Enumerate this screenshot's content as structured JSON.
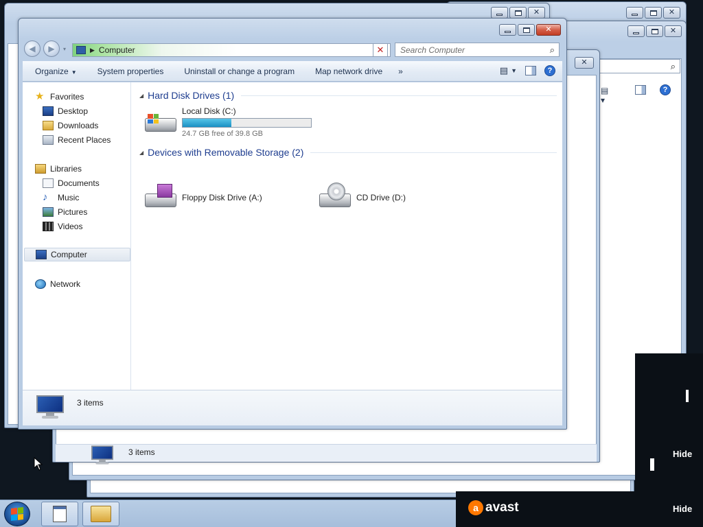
{
  "main_window": {
    "address_path": "Computer",
    "search_placeholder": "Search Computer",
    "toolbar": {
      "organize": "Organize",
      "system_properties": "System properties",
      "uninstall": "Uninstall or change a program",
      "map_network_drive": "Map network drive",
      "more": "»"
    },
    "nav": {
      "favorites": "Favorites",
      "desktop": "Desktop",
      "downloads": "Downloads",
      "recent_places": "Recent Places",
      "libraries": "Libraries",
      "documents": "Documents",
      "music": "Music",
      "pictures": "Pictures",
      "videos": "Videos",
      "computer": "Computer",
      "network": "Network"
    },
    "groups": {
      "hard_disk": "Hard Disk Drives (1)",
      "removable": "Devices with Removable Storage (2)"
    },
    "drives": {
      "local_disk": {
        "name": "Local Disk (C:)",
        "free_text": "24.7 GB free of 39.8 GB",
        "used_fraction": 0.38
      },
      "floppy": {
        "name": "Floppy Disk Drive (A:)"
      },
      "cd": {
        "name": "CD Drive (D:)"
      }
    },
    "status_items": "3 items"
  },
  "background_window": {
    "status_items": "3 items"
  },
  "taskbar": {
    "start_icon": "windows-orb-icon",
    "pinned": [
      "notepad-icon",
      "explorer-folder-icon"
    ]
  },
  "avast": {
    "logo_text": "avast",
    "hide_label_top": "Hide",
    "hide_label_bottom": "Hide"
  },
  "colors": {
    "group_header": "#1e3d8f",
    "capacity_fill": "#1a90c3",
    "avast_orange": "#ff7800"
  }
}
